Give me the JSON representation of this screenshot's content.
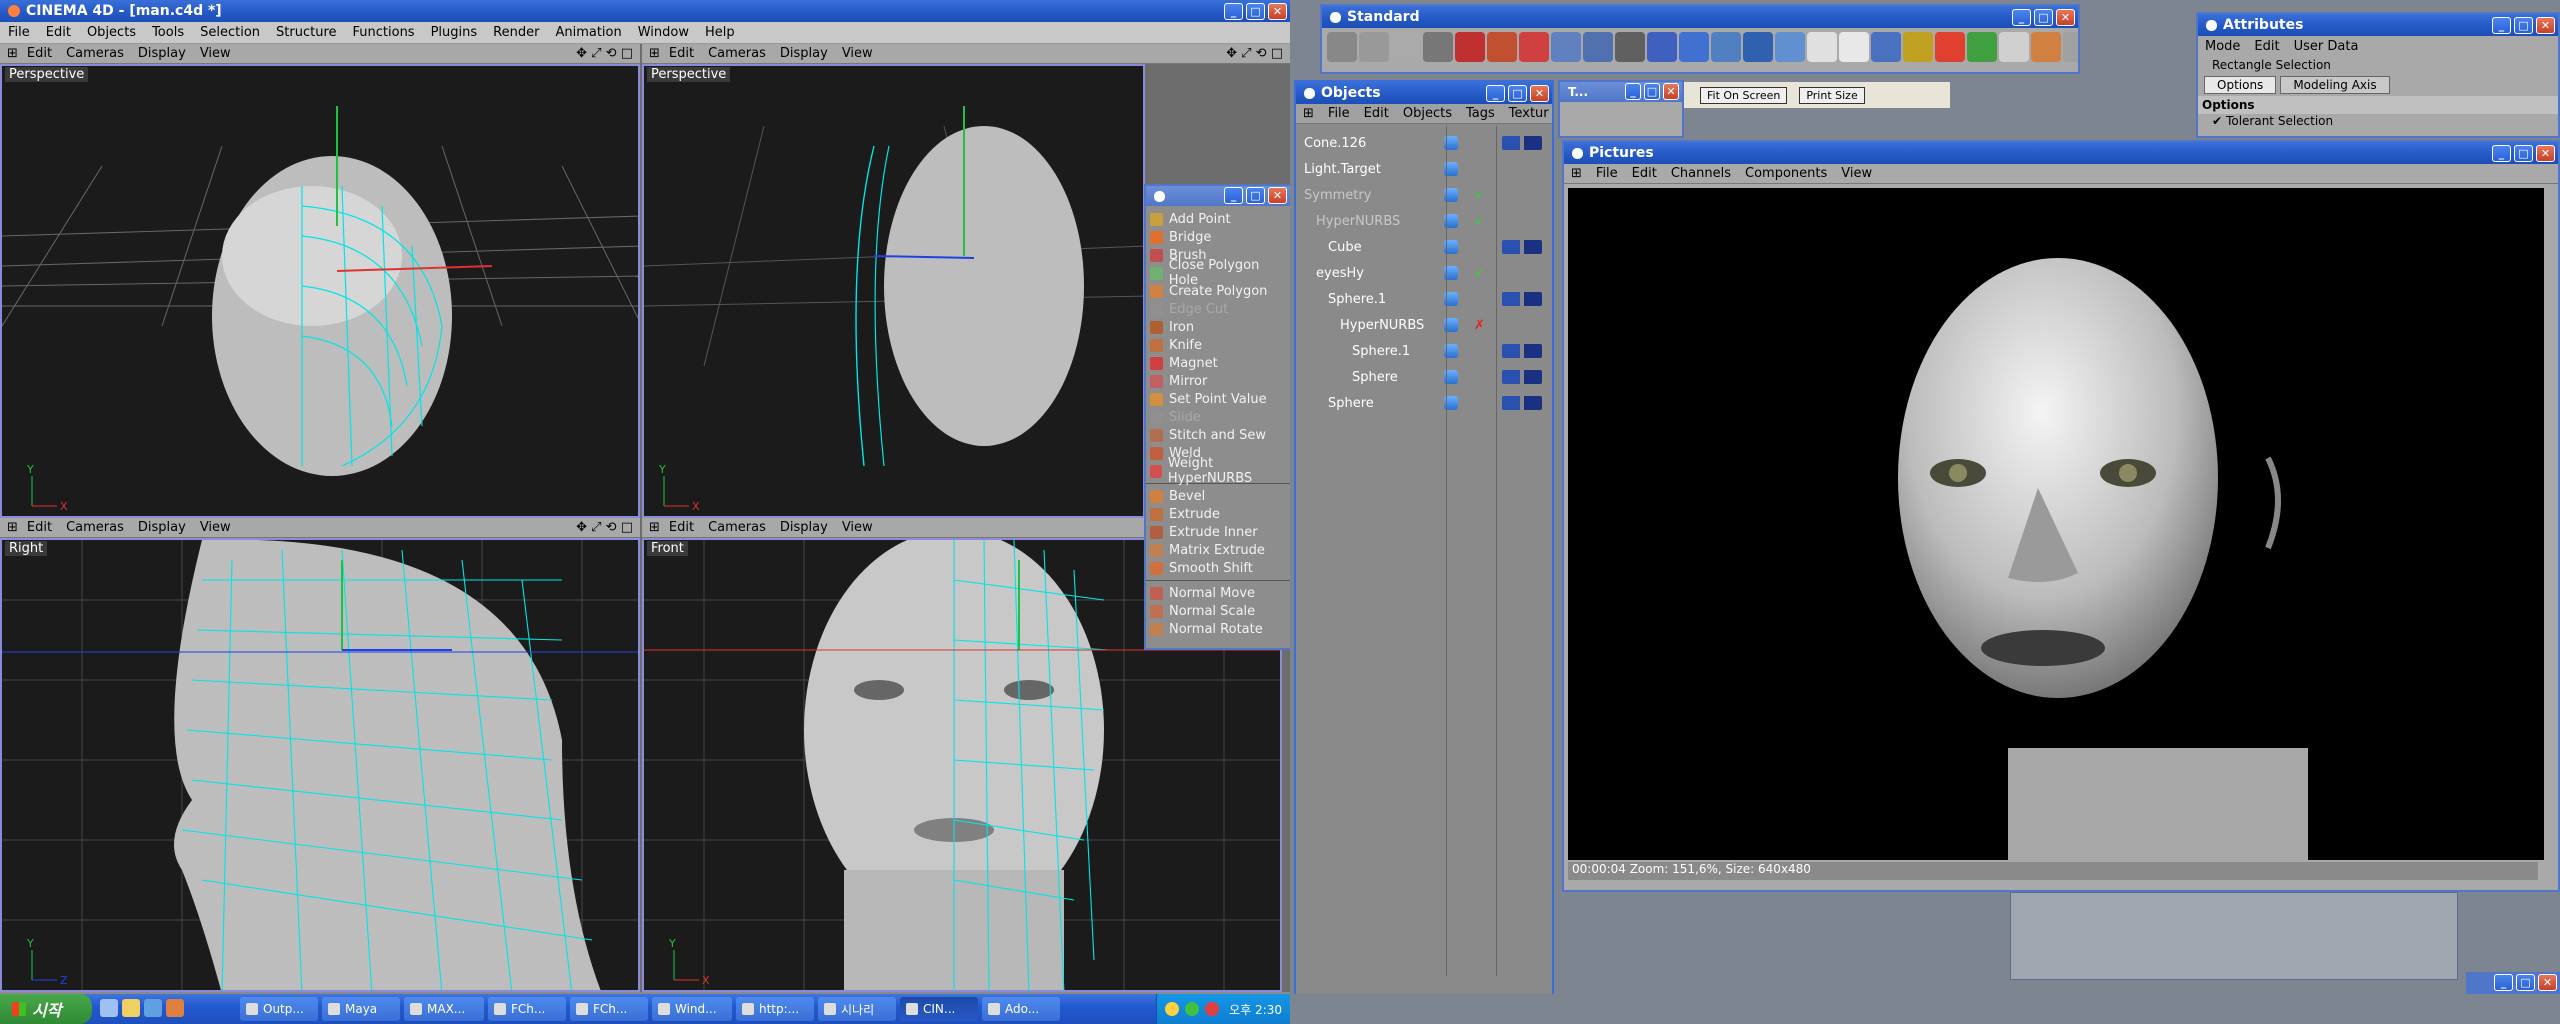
{
  "main_window": {
    "title": "CINEMA 4D - [man.c4d *]",
    "menu": [
      "File",
      "Edit",
      "Objects",
      "Tools",
      "Selection",
      "Structure",
      "Functions",
      "Plugins",
      "Render",
      "Animation",
      "Window",
      "Help"
    ]
  },
  "viewports": [
    {
      "label": "Perspective",
      "menu": [
        "Edit",
        "Cameras",
        "Display",
        "View"
      ]
    },
    {
      "label": "Perspective",
      "menu": [
        "Edit",
        "Cameras",
        "Display",
        "View"
      ]
    },
    {
      "label": "Right",
      "menu": [
        "Edit",
        "Cameras",
        "Display",
        "View"
      ]
    },
    {
      "label": "Front",
      "menu": [
        "Edit",
        "Cameras",
        "Display",
        "View"
      ]
    }
  ],
  "axis_labels": {
    "y": "Y",
    "x": "X",
    "z": "Z"
  },
  "tools_palette": {
    "group1": [
      {
        "label": "Add Point",
        "enabled": true,
        "color": "#c8a040"
      },
      {
        "label": "Bridge",
        "enabled": true,
        "color": "#e07030"
      },
      {
        "label": "Brush",
        "enabled": true,
        "color": "#c05050"
      },
      {
        "label": "Close Polygon Hole",
        "enabled": true,
        "color": "#70b070"
      },
      {
        "label": "Create Polygon",
        "enabled": true,
        "color": "#d08040"
      },
      {
        "label": "Edge Cut",
        "enabled": false,
        "color": "#909090"
      },
      {
        "label": "Iron",
        "enabled": true,
        "color": "#b06030"
      },
      {
        "label": "Knife",
        "enabled": true,
        "color": "#c07040"
      },
      {
        "label": "Magnet",
        "enabled": true,
        "color": "#d04040"
      },
      {
        "label": "Mirror",
        "enabled": true,
        "color": "#c06060"
      },
      {
        "label": "Set Point Value",
        "enabled": true,
        "color": "#d09040"
      },
      {
        "label": "Slide",
        "enabled": false,
        "color": "#909090"
      },
      {
        "label": "Stitch and Sew",
        "enabled": true,
        "color": "#b07050"
      },
      {
        "label": "Weld",
        "enabled": true,
        "color": "#c06040"
      },
      {
        "label": "Weight HyperNURBS",
        "enabled": true,
        "color": "#d05050"
      }
    ],
    "group2": [
      {
        "label": "Bevel",
        "enabled": true,
        "color": "#d08040"
      },
      {
        "label": "Extrude",
        "enabled": true,
        "color": "#c07040"
      },
      {
        "label": "Extrude Inner",
        "enabled": true,
        "color": "#b06040"
      },
      {
        "label": "Matrix Extrude",
        "enabled": true,
        "color": "#c08050"
      },
      {
        "label": "Smooth Shift",
        "enabled": true,
        "color": "#d07040"
      }
    ],
    "group3": [
      {
        "label": "Normal Move",
        "enabled": true,
        "color": "#c06050"
      },
      {
        "label": "Normal Scale",
        "enabled": true,
        "color": "#c07050"
      },
      {
        "label": "Normal Rotate",
        "enabled": true,
        "color": "#c08050"
      }
    ]
  },
  "objects_window": {
    "title": "Objects",
    "menu": [
      "File",
      "Edit",
      "Objects",
      "Tags",
      "Textur"
    ],
    "rows": [
      {
        "name": "Cone.126",
        "indent": 0,
        "dim": false,
        "check": "",
        "tags": true
      },
      {
        "name": "Light.Target",
        "indent": 0,
        "dim": false,
        "check": "",
        "tags": false
      },
      {
        "name": "Symmetry",
        "indent": 0,
        "dim": true,
        "check": "✓",
        "tags": false
      },
      {
        "name": "HyperNURBS",
        "indent": 1,
        "dim": true,
        "check": "✓",
        "tags": false
      },
      {
        "name": "Cube",
        "indent": 2,
        "dim": false,
        "check": "",
        "tags": true
      },
      {
        "name": "eyesHy",
        "indent": 1,
        "dim": false,
        "check": "✓",
        "tags": false
      },
      {
        "name": "Sphere.1",
        "indent": 2,
        "dim": false,
        "check": "",
        "tags": true
      },
      {
        "name": "HyperNURBS",
        "indent": 3,
        "dim": false,
        "check": "✗",
        "tags": false
      },
      {
        "name": "Sphere.1",
        "indent": 4,
        "dim": false,
        "check": "",
        "tags": true
      },
      {
        "name": "Sphere",
        "indent": 4,
        "dim": false,
        "check": "",
        "tags": true
      },
      {
        "name": "Sphere",
        "indent": 2,
        "dim": false,
        "check": "",
        "tags": true
      }
    ]
  },
  "standard_window": {
    "title": "Standard"
  },
  "small_window": {
    "title": "T...",
    "fit_btn": "Fit On Screen",
    "print_btn": "Print Size"
  },
  "attributes_window": {
    "title": "Attributes",
    "menu": [
      "Mode",
      "Edit",
      "User Data"
    ],
    "subtitle": "Rectangle Selection",
    "tabs": [
      "Options",
      "Modeling Axis"
    ],
    "section": "Options",
    "option": "Tolerant Selection"
  },
  "pictures_window": {
    "title": "Pictures",
    "menu": [
      "File",
      "Edit",
      "Channels",
      "Components",
      "View"
    ],
    "status": "00:00:04   Zoom: 151,6%, Size: 640x480"
  },
  "taskbar": {
    "start_label": "시작",
    "buttons": [
      "Outp...",
      "Maya",
      "MAX...",
      "FCh...",
      "FCh...",
      "Wind...",
      "http:...",
      "시나리",
      "CIN...",
      "Ado..."
    ],
    "active_index": 8,
    "clock": "오후 2:30"
  },
  "colors": {
    "wire": "#00e5e5",
    "viewport_bg": "#1b1b1b",
    "title_blue": "#2358c5"
  }
}
